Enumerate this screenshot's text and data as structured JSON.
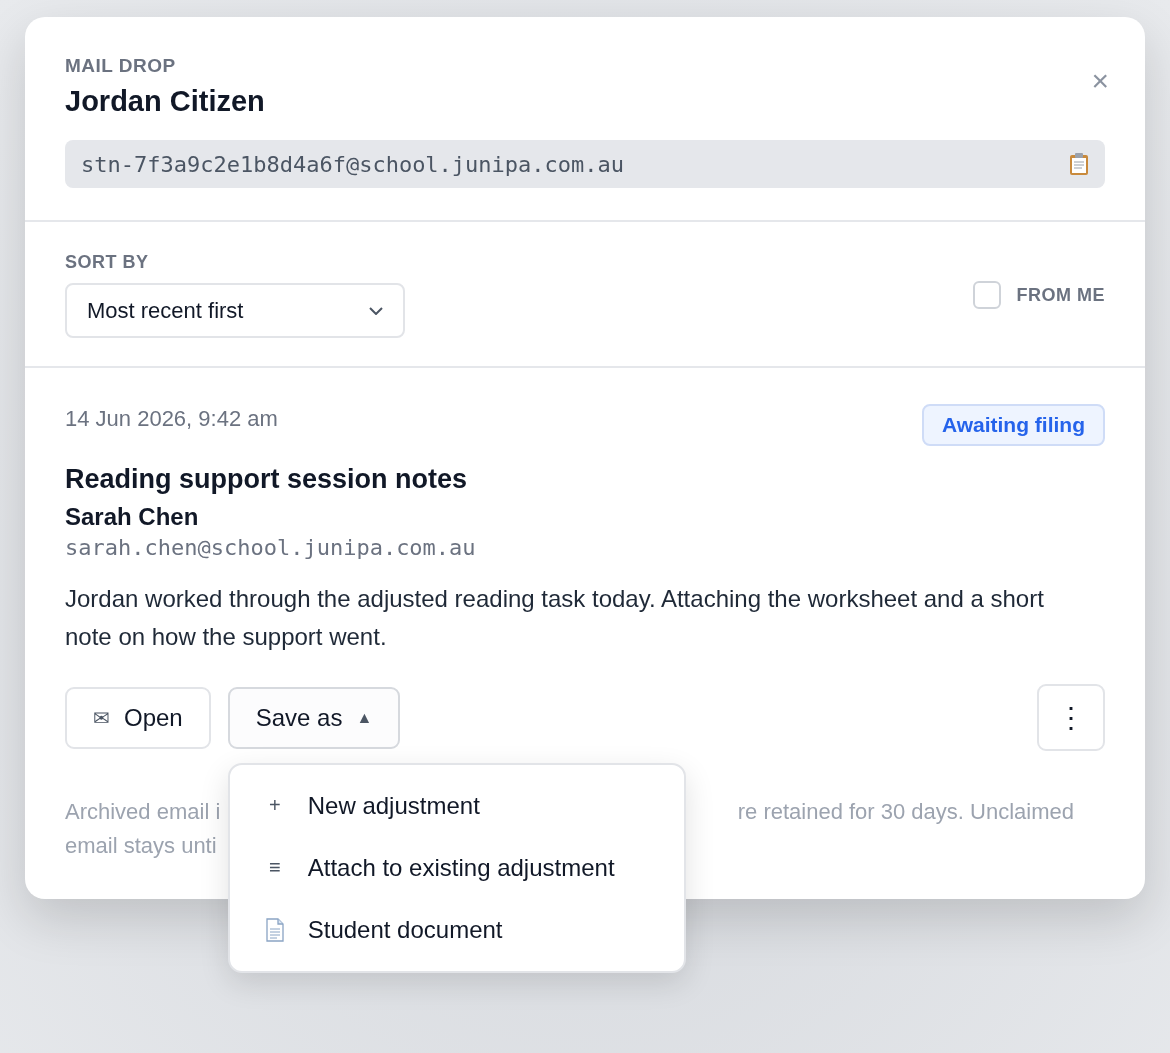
{
  "header": {
    "eyebrow": "MAIL DROP",
    "title": "Jordan Citizen",
    "address": "stn-7f3a9c2e1b8d4a6f@school.junipa.com.au",
    "close": "×"
  },
  "sort": {
    "label": "SORT BY",
    "value": "Most recent first",
    "from_me": {
      "label": "FROM ME",
      "checked": false
    }
  },
  "message": {
    "date": "14 Jun 2026, 9:42 am",
    "status": "Awaiting filing",
    "subject": "Reading support session notes",
    "sender": "Sarah Chen",
    "sender_email": "sarah.chen@school.junipa.com.au",
    "body": "Jordan worked through the adjusted reading task today. Attaching the worksheet and a short note on how the support went."
  },
  "actions": {
    "open": {
      "icon": "✉",
      "label": "Open"
    },
    "save_as": {
      "label": "Save as",
      "caret": "▲",
      "expanded": true
    },
    "more": "⋮"
  },
  "menu": [
    {
      "kind": "plus",
      "icon": "+",
      "label": "New adjustment"
    },
    {
      "kind": "list",
      "icon": "≡",
      "label": "Attach to existing adjustment"
    },
    {
      "kind": "document",
      "label": "Student document"
    }
  ],
  "footer": {
    "line_1_start": "Archived email i",
    "line_1_end": "re retained for 30 days. Unclaimed",
    "line_2_start": "email stays unti"
  }
}
